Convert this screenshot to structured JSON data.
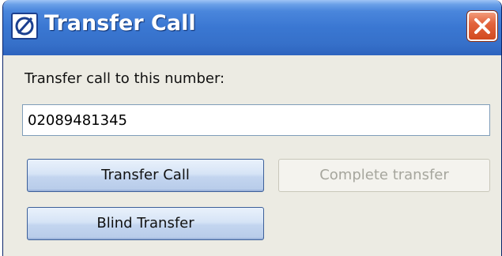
{
  "window": {
    "title": "Transfer Call",
    "icon": "app-logo-icon",
    "close_icon": "close-icon"
  },
  "form": {
    "prompt": "Transfer call to this number:",
    "number_value": "02089481345"
  },
  "buttons": {
    "transfer_call": "Transfer Call",
    "complete_transfer": "Complete transfer",
    "blind_transfer": "Blind Transfer"
  },
  "colors": {
    "titlebar": "#3a77d2",
    "close": "#e3643d",
    "body": "#ecebe3"
  }
}
